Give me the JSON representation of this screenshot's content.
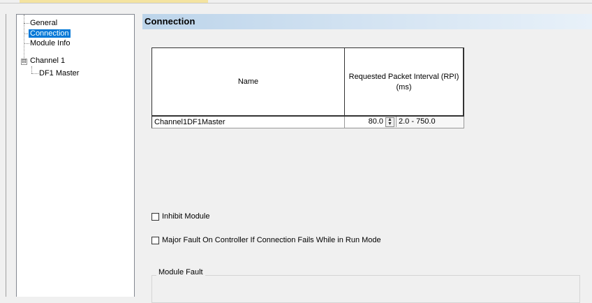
{
  "tree": {
    "items": [
      {
        "label": "General",
        "selected": false
      },
      {
        "label": "Connection",
        "selected": true
      },
      {
        "label": "Module Info",
        "selected": false
      },
      {
        "label": "Channel 1",
        "selected": false,
        "expander": "⊟"
      },
      {
        "label": "DF1 Master",
        "selected": false
      }
    ]
  },
  "main": {
    "section_title": "Connection",
    "table": {
      "headers": {
        "name": "Name",
        "rpi_line1": "Requested Packet Interval (RPI)",
        "rpi_line2": "(ms)"
      },
      "rows": [
        {
          "name": "Channel1DF1Master",
          "rpi": "80.0",
          "range": "2.0 - 750.0"
        }
      ]
    },
    "checkboxes": {
      "inhibit": {
        "label": "Inhibit Module",
        "checked": false
      },
      "major_fault": {
        "label": "Major Fault On Controller If Connection Fails While in Run Mode",
        "checked": false
      }
    },
    "module_fault": {
      "title": "Module Fault"
    }
  },
  "colors": {
    "selection": "#0078d7",
    "header_gradient_start": "#bcd4ea",
    "header_gradient_end": "#e8f1f9"
  },
  "icons": {
    "expander": "collapse-icon",
    "spinner": "spinner-arrows-icon"
  }
}
